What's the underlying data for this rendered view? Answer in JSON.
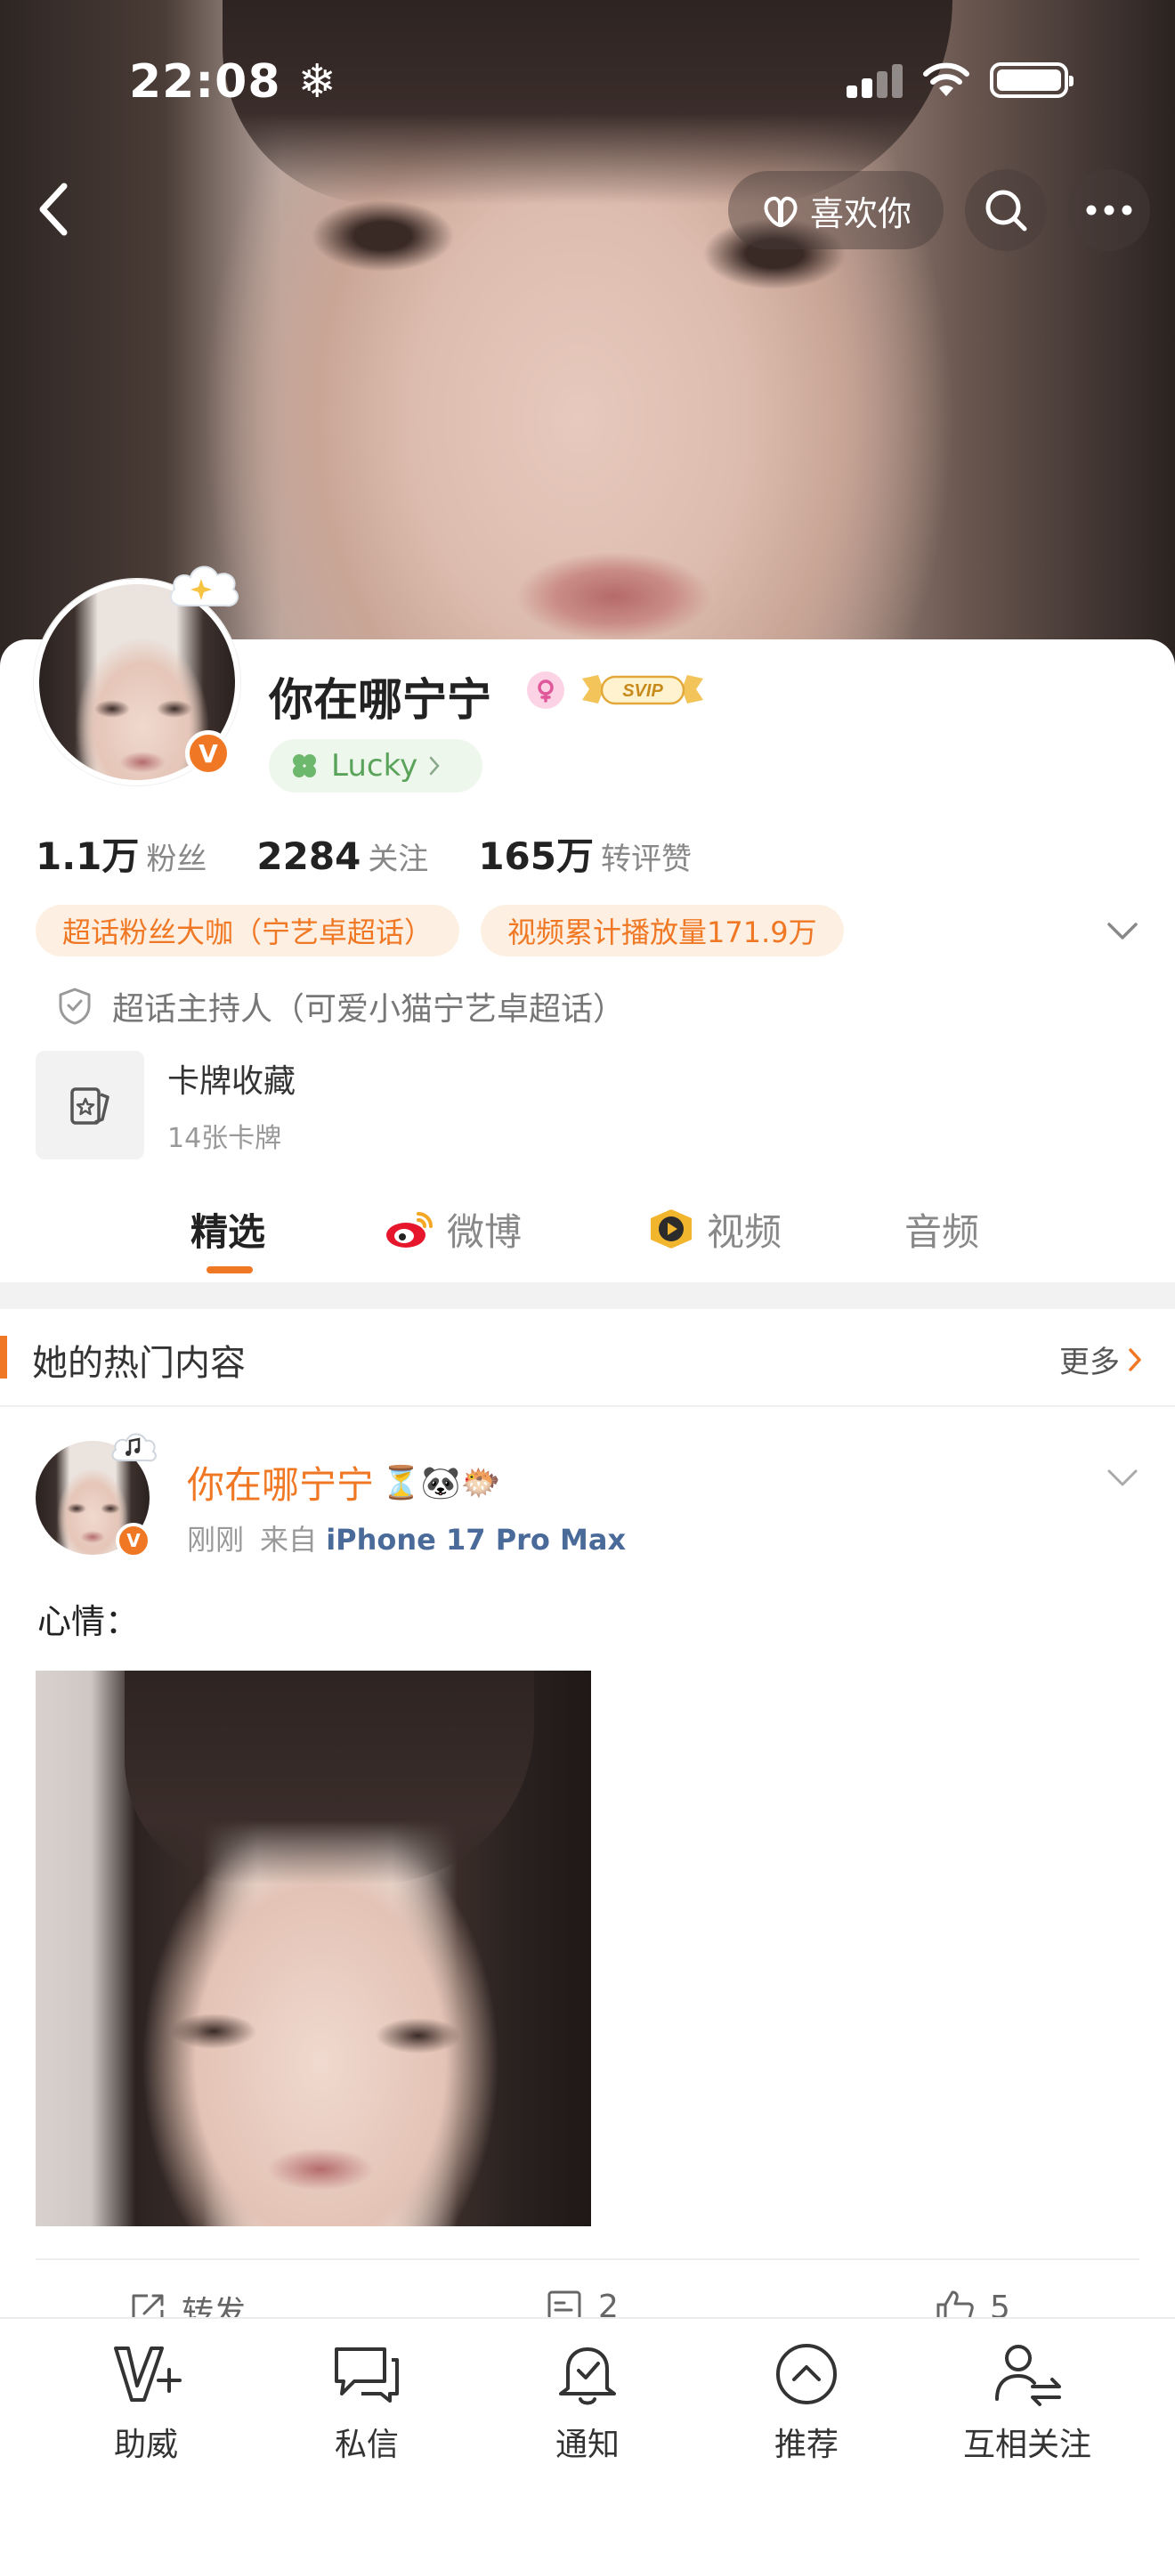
{
  "status_bar": {
    "time": "22:08 ❄"
  },
  "nav": {
    "like_label": "喜欢你"
  },
  "profile": {
    "name": "你在哪宁宁",
    "svip_label": "SVIP",
    "lucky_label": "Lucky",
    "verify_mark": "V",
    "stats": [
      {
        "num": "1.1万",
        "label": "粉丝"
      },
      {
        "num": "2284",
        "label": "关注"
      },
      {
        "num": "165万",
        "label": "转评赞"
      }
    ],
    "tags": [
      "超话粉丝大咖（宁艺卓超话）",
      "视频累计播放量171.9万"
    ],
    "host_line": "超话主持人（可爱小猫宁艺卓超话）",
    "collection": {
      "title": "卡牌收藏",
      "subtitle": "14张卡牌"
    }
  },
  "tabs": [
    {
      "label": "精选",
      "icon": ""
    },
    {
      "label": "微博",
      "icon": "weibo-icon"
    },
    {
      "label": "视频",
      "icon": "video-icon"
    },
    {
      "label": "音频",
      "icon": ""
    }
  ],
  "hot_section": {
    "title": "她的热门内容",
    "more_label": "更多"
  },
  "post": {
    "author": "你在哪宁宁",
    "author_emojis": "⏳🐼🐡",
    "time": "刚刚",
    "source_prefix": "来自",
    "device": "iPhone 17 Pro Max",
    "text": "心情：",
    "actions": [
      {
        "label": "转发",
        "icon": "repost-icon"
      },
      {
        "label": "2",
        "icon": "comment-icon"
      },
      {
        "label": "5",
        "icon": "like-icon"
      }
    ]
  },
  "bottom_bar": [
    {
      "label": "助威",
      "icon": "v-plus-icon"
    },
    {
      "label": "私信",
      "icon": "message-icon"
    },
    {
      "label": "通知",
      "icon": "bell-icon"
    },
    {
      "label": "推荐",
      "icon": "recommend-icon"
    },
    {
      "label": "互相关注",
      "icon": "mutual-follow-icon"
    }
  ],
  "colors": {
    "accent": "#f07824",
    "link": "#4a6a9a",
    "lucky_green": "#5aa35a"
  }
}
